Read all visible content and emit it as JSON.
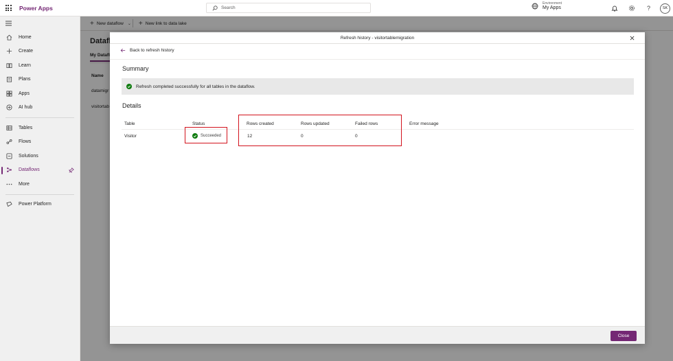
{
  "topbar": {
    "app_title": "Power Apps",
    "search_placeholder": "Search",
    "environment_label": "Environment",
    "environment_name": "My Apps",
    "avatar_initials": "SK",
    "help_label": "?"
  },
  "nav": {
    "items": [
      {
        "label": "Home",
        "icon": "home-icon"
      },
      {
        "label": "Create",
        "icon": "plus-icon"
      },
      {
        "label": "Learn",
        "icon": "book-icon"
      },
      {
        "label": "Plans",
        "icon": "clipboard-icon"
      },
      {
        "label": "Apps",
        "icon": "apps-icon"
      },
      {
        "label": "AI hub",
        "icon": "ai-hub-icon"
      },
      {
        "label": "Tables",
        "icon": "table-icon"
      },
      {
        "label": "Flows",
        "icon": "flow-icon"
      },
      {
        "label": "Solutions",
        "icon": "solutions-icon"
      },
      {
        "label": "Dataflows",
        "icon": "dataflow-icon"
      },
      {
        "label": "More",
        "icon": "ellipsis-icon"
      },
      {
        "label": "Power Platform",
        "icon": "power-platform-icon"
      }
    ],
    "active": "Dataflows"
  },
  "background": {
    "cmd_new_dataflow": "New dataflow",
    "cmd_new_link": "New link to data lake",
    "page_title": "Dataflo",
    "pivot_tab": "My Datafl",
    "col_name": "Name",
    "row1": "datamigr",
    "row2": "visitortab"
  },
  "dialog": {
    "title": "Refresh history - visitortablemigration",
    "back_link": "Back to refresh history",
    "summary_title": "Summary",
    "banner_text": "Refresh completed successfully for all tables in the dataflow.",
    "details_title": "Details",
    "columns": {
      "table": "Table",
      "status": "Status",
      "rows_created": "Rows created",
      "rows_updated": "Rows updated",
      "failed_rows": "Failed rows",
      "error_message": "Error message"
    },
    "row": {
      "table": "Visitor",
      "status": "Succeeded",
      "rows_created": "12",
      "rows_updated": "0",
      "failed_rows": "0",
      "error_message": ""
    },
    "close_button": "Close"
  },
  "colors": {
    "brand": "#742774",
    "success": "#107c10",
    "highlight": "#d2111b"
  }
}
